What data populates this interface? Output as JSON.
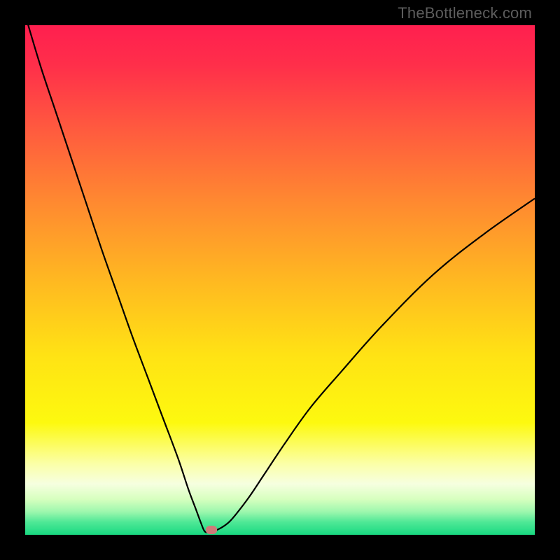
{
  "watermark": "TheBottleneck.com",
  "chart_data": {
    "type": "line",
    "title": "",
    "xlabel": "",
    "ylabel": "",
    "xlim": [
      0,
      100
    ],
    "ylim": [
      0,
      100
    ],
    "gradient_stops": [
      {
        "offset": 0.0,
        "color": "#ff1f4f"
      },
      {
        "offset": 0.08,
        "color": "#ff2f4a"
      },
      {
        "offset": 0.2,
        "color": "#ff593f"
      },
      {
        "offset": 0.35,
        "color": "#ff8a30"
      },
      {
        "offset": 0.5,
        "color": "#ffb821"
      },
      {
        "offset": 0.65,
        "color": "#ffe314"
      },
      {
        "offset": 0.78,
        "color": "#fdf90f"
      },
      {
        "offset": 0.86,
        "color": "#fbffa6"
      },
      {
        "offset": 0.9,
        "color": "#f6ffe0"
      },
      {
        "offset": 0.93,
        "color": "#d7ffbf"
      },
      {
        "offset": 0.955,
        "color": "#9cf7ad"
      },
      {
        "offset": 0.975,
        "color": "#4fe896"
      },
      {
        "offset": 1.0,
        "color": "#18d981"
      }
    ],
    "series": [
      {
        "name": "bottleneck-curve",
        "x": [
          0,
          3,
          6,
          9,
          12,
          15,
          18,
          21,
          24,
          27,
          30,
          32,
          33.5,
          34.5,
          35.2,
          36,
          37,
          38.5,
          40,
          41.5,
          44,
          47,
          51,
          56,
          62,
          70,
          80,
          90,
          100
        ],
        "y": [
          102,
          92,
          83,
          74,
          65,
          56,
          47.5,
          39,
          31,
          23,
          15,
          9,
          5,
          2.3,
          0.7,
          0.5,
          0.7,
          1.4,
          2.5,
          4.2,
          7.5,
          12,
          18,
          25,
          32,
          41,
          51,
          59,
          66
        ]
      }
    ],
    "marker": {
      "x": 36.5,
      "y": 0.9,
      "color": "#cf7a79"
    }
  }
}
